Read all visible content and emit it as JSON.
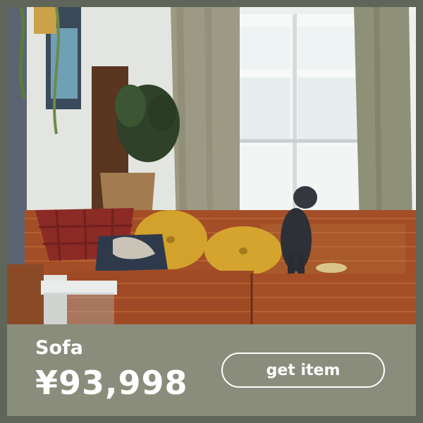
{
  "product": {
    "name": "Sofa",
    "price": "¥93,998",
    "cta_label": "get item"
  },
  "photo": {
    "subject": "sofa-with-dog-photo"
  },
  "colors": {
    "frame": "#5f6659",
    "info_panel": "#8a8d7b",
    "text": "#ffffff"
  }
}
